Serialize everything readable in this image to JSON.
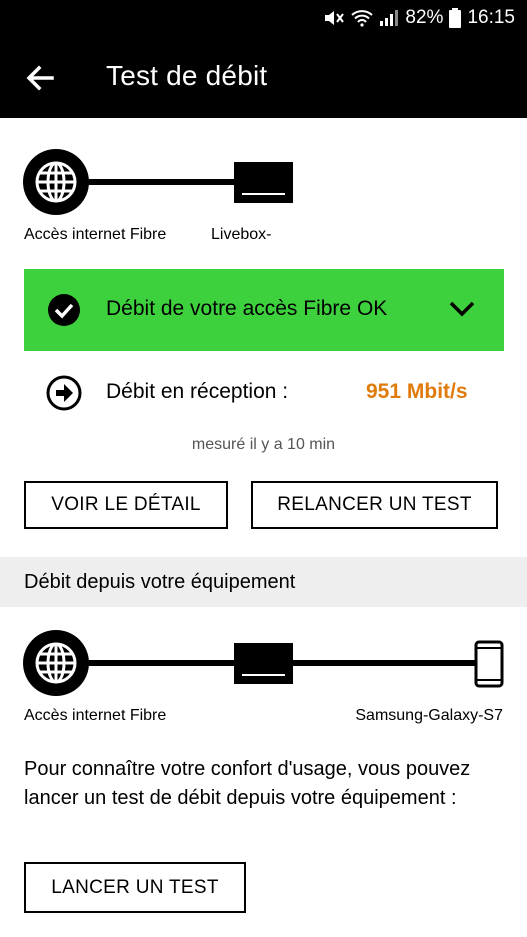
{
  "status_bar": {
    "battery": "82%",
    "time": "16:15"
  },
  "app_bar": {
    "title": "Test de débit"
  },
  "line_diagram": {
    "source_label": "Accès internet Fibre",
    "box_label": "Livebox-"
  },
  "fibre_status": {
    "text": "Débit de votre accès Fibre OK",
    "color": "#3ed13e"
  },
  "reception": {
    "label": "Débit en réception :",
    "value": "951 Mbit/s",
    "value_color": "#e07b0c",
    "measured": "mesuré il y a 10 min"
  },
  "buttons": {
    "detail": "VOIR LE DÉTAIL",
    "retest": "RELANCER UN TEST",
    "launch": "LANCER UN TEST"
  },
  "equipment_section": {
    "title": "Débit depuis votre équipement",
    "source_label": "Accès internet Fibre",
    "device_label": "Samsung-Galaxy-S7",
    "description": "Pour connaître votre confort d'usage, vous pouvez lancer un test de débit depuis votre équipement :"
  }
}
